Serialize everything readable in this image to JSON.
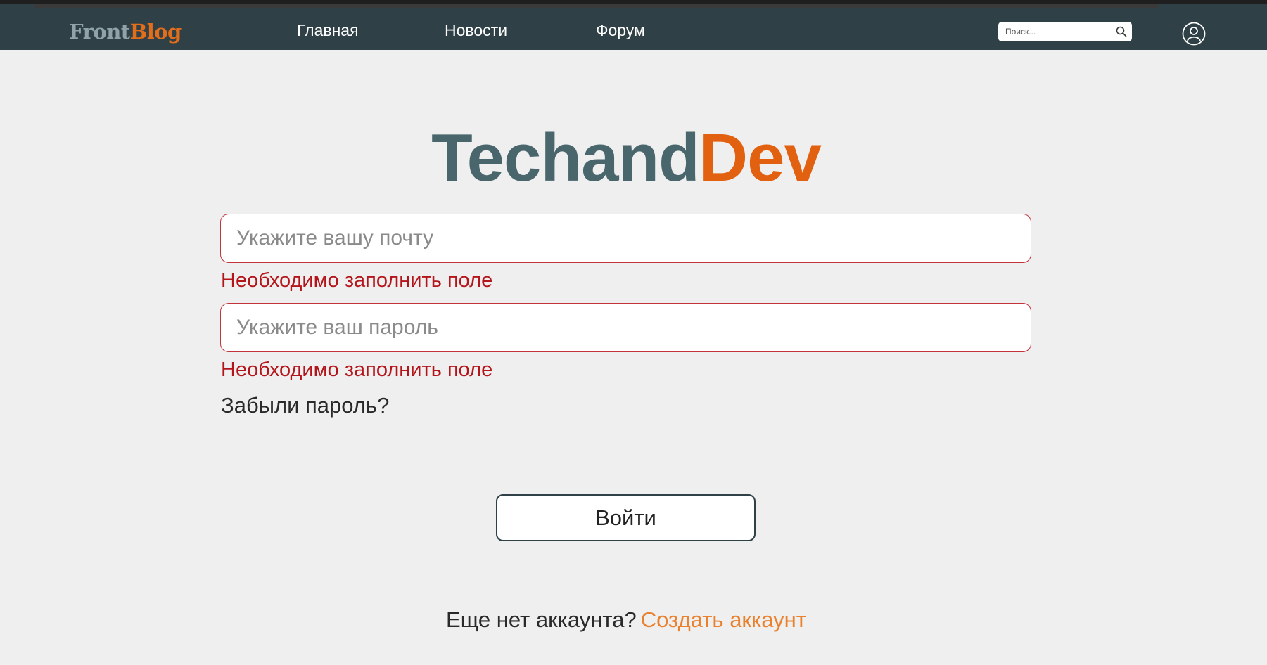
{
  "header": {
    "brand_part1": "Front",
    "brand_part2": "Blog",
    "nav": [
      {
        "label": "Главная"
      },
      {
        "label": "Новости"
      },
      {
        "label": "Форум"
      }
    ],
    "search_placeholder": "Поиск...",
    "search_icon": "search-icon",
    "user_icon": "user-icon"
  },
  "login": {
    "logo_part1": "Techand",
    "logo_part2": "Dev",
    "email_placeholder": "Укажите вашу почту",
    "email_value": "",
    "email_error": "Необходимо заполнить поле",
    "password_placeholder": "Укажите ваш пароль",
    "password_value": "",
    "password_error": "Необходимо заполнить поле",
    "forgot_label": "Забыли пароль?",
    "submit_label": "Войти",
    "no_account_text": "Еще нет аккаунта?",
    "create_account_label": "Создать аккаунт"
  },
  "colors": {
    "header_bg": "#2f4147",
    "brand_accent": "#e26d1a",
    "logo_primary": "#4a666d",
    "logo_accent": "#e26110",
    "error": "#b4151b",
    "link": "#e9812f"
  }
}
